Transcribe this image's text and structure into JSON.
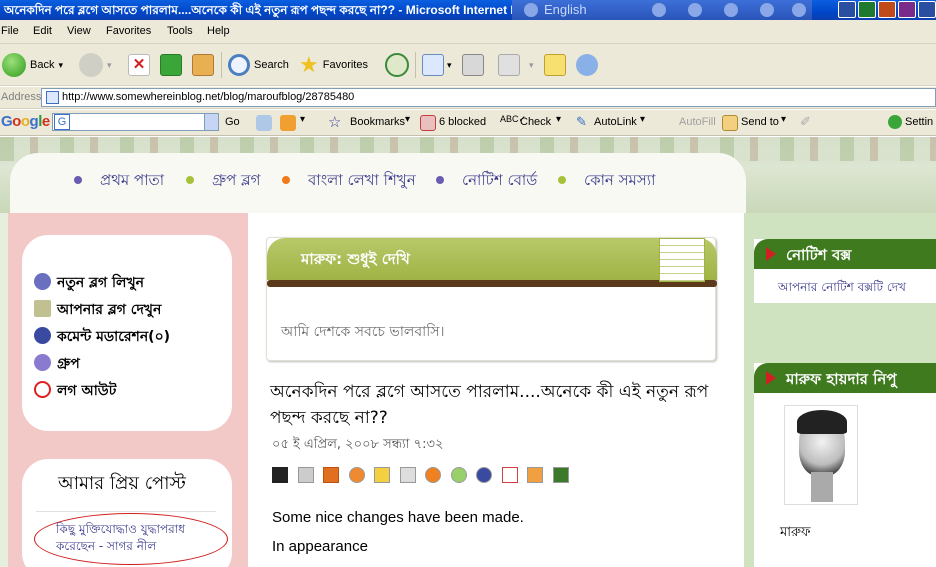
{
  "window": {
    "title": "অনেকদিন পরে ব্লগে আসতে পারলাম....অনেকে কী এই নতুন রূপ পছন্দ করছে না?? - Microsoft Internet Explorer",
    "language": "English"
  },
  "menu": [
    "File",
    "Edit",
    "View",
    "Favorites",
    "Tools",
    "Help"
  ],
  "toolbar": {
    "back": "Back",
    "search": "Search",
    "favorites": "Favorites"
  },
  "address": {
    "label": "Address",
    "url": "http://www.somewhereinblog.net/blog/maroufblog/28785480"
  },
  "google_bar": {
    "go": "Go",
    "bookmarks": "Bookmarks",
    "blocked": "6 blocked",
    "check": "Check",
    "autolink": "AutoLink",
    "autofill": "AutoFill",
    "sendto": "Send to",
    "settings": "Settin"
  },
  "nav": {
    "items": [
      "প্রথম পাতা",
      "গ্রুপ ব্লগ",
      "বাংলা লেখা শিখুন",
      "নোটিশ বোর্ড",
      "কোন সমস্যা"
    ],
    "dot_colors": [
      "#6a5cb0",
      "#a6c23a",
      "#f07a1a",
      "#6a5cb0",
      "#a6c23a"
    ]
  },
  "sidebar": {
    "items": [
      {
        "label": "নতুন ব্লগ লিখুন",
        "icon": "pencil-icon",
        "color": "#6a70c0"
      },
      {
        "label": "আপনার ব্লগ দেখুন",
        "icon": "page-icon",
        "color": "#c0c090"
      },
      {
        "label": "কমেন্ট মডারেশন(০)",
        "icon": "shield-icon",
        "color": "#3a4aa0"
      },
      {
        "label": "গ্রুপ",
        "icon": "group-icon",
        "color": "#8a7ad0"
      },
      {
        "label": "লগ আউট",
        "icon": "no-icon",
        "color": "#e02020"
      }
    ],
    "favorites_title": "আমার প্রিয় পোস্ট",
    "favorite_post": "কিছু মুক্তিযোদ্ধাও যুদ্ধাপরাধ করেছেন - সাগর নীল"
  },
  "blog": {
    "header_title": "মারুফ: শুধুই দেখি",
    "tagline": "আমি দেশকে সবচে ভালবাসি।"
  },
  "post": {
    "title": "অনেকদিন পরে ব্লগে আসতে পারলাম....অনেকে কী এই নতুন রূপ পছন্দ করছে না??",
    "date": "০৫ ই এপ্রিল, ২০০৮ সন্ধ্যা ৭:৩২",
    "body": [
      "Some nice changes have been made.",
      "In appearance"
    ]
  },
  "right": {
    "notice_title": "নোটিশ বক্স",
    "notice_text": "আপনার নোটিশ বক্সটি দেখ",
    "author_title": "মারুফ হায়দার নিপু",
    "author_name": "মারুফ"
  }
}
